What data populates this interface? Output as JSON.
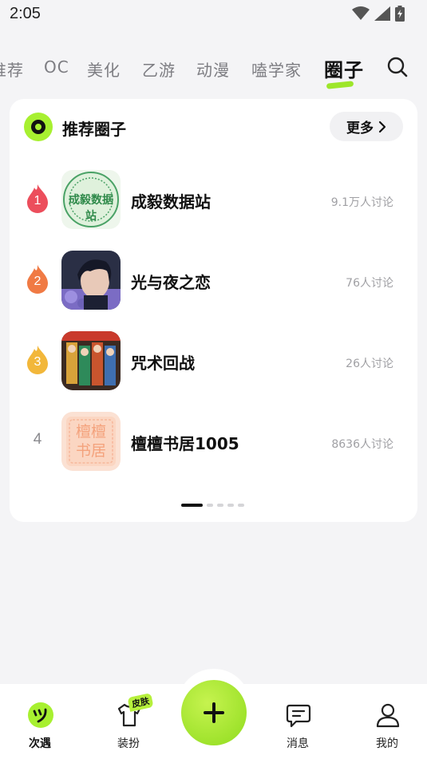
{
  "status_bar": {
    "time": "2:05"
  },
  "tabs": [
    {
      "label": "推荐",
      "active": false
    },
    {
      "label": "OC",
      "active": false
    },
    {
      "label": "美化",
      "active": false
    },
    {
      "label": "乙游",
      "active": false
    },
    {
      "label": "动漫",
      "active": false
    },
    {
      "label": "嗑学家",
      "active": false
    },
    {
      "label": "圈子",
      "active": true
    }
  ],
  "card": {
    "title": "推荐圈子",
    "more_label": "更多",
    "items": [
      {
        "rank": "1",
        "name": "成毅数据站",
        "count": "9.1万人讨论",
        "badge_color": "#ec4e5c",
        "thumb_text": "成毅数据站"
      },
      {
        "rank": "2",
        "name": "光与夜之恋",
        "count": "76人讨论",
        "badge_color": "#f07a44"
      },
      {
        "rank": "3",
        "name": "咒术回战",
        "count": "26人讨论",
        "badge_color": "#f2b73a"
      },
      {
        "rank": "4",
        "name": "檀檀书居1005",
        "count": "8636人讨论",
        "thumb_text": "檀檀书居"
      }
    ],
    "pagination": {
      "total": 5,
      "current": 1
    }
  },
  "bottom_nav": {
    "items": [
      {
        "label": "次遇",
        "icon": "cyy-logo-icon",
        "active": true
      },
      {
        "label": "装扮",
        "icon": "shirt-icon",
        "badge": "皮肤"
      },
      {
        "label": "消息",
        "icon": "message-icon"
      },
      {
        "label": "我的",
        "icon": "profile-icon"
      }
    ],
    "fab_icon": "plus-icon"
  },
  "colors": {
    "accent": "#a7f030",
    "background": "#f4f4f6"
  }
}
